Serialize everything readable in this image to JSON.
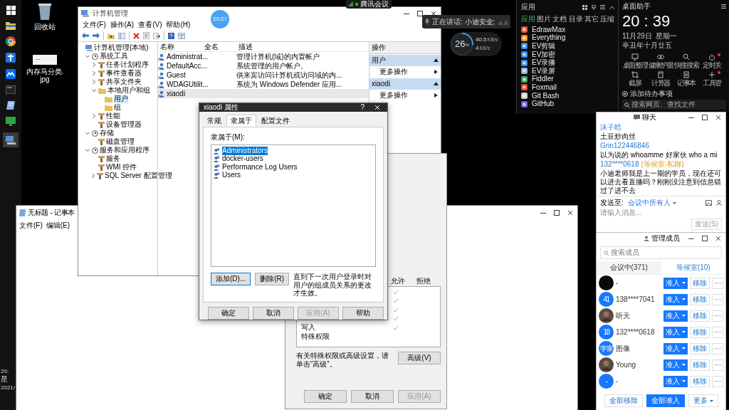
{
  "desktop_icons": [
    {
      "label": "回收站"
    },
    {
      "label": "内存马分类.jpg"
    }
  ],
  "taskbar_clock": [
    "20:",
    "星",
    "2021/"
  ],
  "meeting_bar": {
    "title": "腾讯会议"
  },
  "timer": "29:27",
  "speaking_toast": {
    "text": "正在讲话: 小迪安全;"
  },
  "network_monitor": {
    "level": 0.26,
    "usage": "26",
    "unit": "%",
    "upload": "40.5",
    "upload_unit": "KB/s",
    "download": "4",
    "download_unit": "KB/s"
  },
  "computer_management": {
    "title": "计算机管理",
    "menu": [
      "文件(F)",
      "操作(A)",
      "查看(V)",
      "帮助(H)"
    ],
    "tree": [
      {
        "label": "计算机管理(本地)",
        "selected": false,
        "children": [
          {
            "label": "系统工具",
            "expanded": true,
            "selected": false,
            "children": [
              {
                "label": "任务计划程序",
                "expanded": false,
                "selected": false
              },
              {
                "label": "事件查看器",
                "expanded": false,
                "selected": false
              },
              {
                "label": "共享文件夹",
                "expanded": false,
                "selected": false
              },
              {
                "label": "本地用户和组",
                "expanded": true,
                "selected": false,
                "children": [
                  {
                    "label": "用户",
                    "selected": true
                  },
                  {
                    "label": "组",
                    "selected": false
                  }
                ]
              },
              {
                "label": "性能",
                "expanded": false,
                "selected": false
              },
              {
                "label": "设备管理器",
                "selected": false
              }
            ]
          },
          {
            "label": "存储",
            "expanded": true,
            "selected": false,
            "children": [
              {
                "label": "磁盘管理",
                "selected": false
              }
            ]
          },
          {
            "label": "服务和应用程序",
            "expanded": true,
            "selected": false,
            "children": [
              {
                "label": "服务",
                "selected": false
              },
              {
                "label": "WMI 控件",
                "selected": false
              },
              {
                "label": "SQL Server 配置管理",
                "expanded": false,
                "selected": false
              }
            ]
          }
        ]
      }
    ],
    "columns": [
      "名称",
      "全名",
      "描述"
    ],
    "rows": [
      {
        "name": "Administrat...",
        "description": "管理计算机(域)的内置帐户",
        "selected": false
      },
      {
        "name": "DefaultAcc...",
        "description": "系统管理的用户帐户。",
        "selected": false
      },
      {
        "name": "Guest",
        "description": "供来宾访问计算机或访问域的内...",
        "selected": false
      },
      {
        "name": "WDAGUtilit...",
        "description": "系统为 Windows Defender 应用...",
        "selected": false
      },
      {
        "name": "xiaodi",
        "selected": true
      }
    ],
    "actions": {
      "title": "操作",
      "sections": [
        {
          "title": "用户",
          "items": [
            "更多操作"
          ]
        },
        {
          "title": "xiaodi",
          "items": [
            "更多操作"
          ]
        }
      ]
    }
  },
  "notepad": {
    "title": "无标题 - 记事本",
    "menu": [
      "文件(F)",
      "编辑(E)"
    ]
  },
  "permissions": {
    "columns": [
      "允许",
      "拒绝"
    ],
    "rows": [
      {
        "allow": true,
        "deny": false
      },
      {
        "allow": true,
        "deny": false
      },
      {
        "allow": true,
        "deny": false
      },
      {
        "allow": true,
        "deny": false
      },
      {
        "label": "写入",
        "allow": true,
        "deny": false
      },
      {
        "label": "特殊权限",
        "allow": false,
        "deny": false
      }
    ],
    "note": "有关特殊权限或高级设置，请单击“高级”。",
    "advanced_button": "高级(V)",
    "buttons": [
      {
        "label": "确定",
        "disabled": false
      },
      {
        "label": "取消",
        "disabled": false
      },
      {
        "label": "应用(A)",
        "disabled": true
      }
    ]
  },
  "properties_dialog": {
    "title": "xiaodi 属性",
    "help": "?",
    "tabs": [
      {
        "label": "常规",
        "selected": false
      },
      {
        "label": "隶属于",
        "selected": true
      },
      {
        "label": "配置文件",
        "selected": false
      }
    ],
    "member_of_label": "隶属于(M):",
    "groups": [
      {
        "name": "Administrators",
        "selected": true
      },
      {
        "name": "docker-users",
        "selected": false
      },
      {
        "name": "Performance Log Users",
        "selected": false
      },
      {
        "name": "Users",
        "selected": false
      }
    ],
    "add_button": "添加(D)...",
    "remove_button": "删除(R)",
    "note": "直到下一次用户登录时对用户的组成员关系的更改才生效。",
    "buttons": [
      {
        "label": "确定",
        "disabled": false
      },
      {
        "label": "取消",
        "disabled": false
      },
      {
        "label": "应用(A)",
        "disabled": true
      },
      {
        "label": "帮助",
        "disabled": false
      }
    ]
  },
  "app_launcher": {
    "title": "应用",
    "tabs": [
      {
        "label": "应用",
        "selected": true
      },
      {
        "label": "图片",
        "selected": false
      },
      {
        "label": "文档",
        "selected": false
      },
      {
        "label": "目录",
        "selected": false
      },
      {
        "label": "其它",
        "selected": false
      },
      {
        "label": "压缩",
        "selected": false
      }
    ],
    "apps": [
      "EdrawMax",
      "Everything",
      "EV剪辑",
      "EV加密",
      "EV录播",
      "EV录屏",
      "Fiddler",
      "Foxmail",
      "Git Bash",
      "GitHub"
    ]
  },
  "desktop_assistant": {
    "title": "桌面助手",
    "time": "20 : 39",
    "date": "11月29日",
    "weekday": "星期一",
    "lunar": "辛丑年十月廿五",
    "tools": [
      {
        "label": "桌面整理",
        "badge": false
      },
      {
        "label": "健康护眼",
        "badge": false
      },
      {
        "label": "快搜搜索",
        "badge": false
      },
      {
        "label": "定时关",
        "badge": true
      },
      {
        "label": "截屏",
        "badge": false
      },
      {
        "label": "计算器",
        "badge": false
      },
      {
        "label": "记事本",
        "badge": false
      },
      {
        "label": "工具管",
        "badge": true
      }
    ],
    "add_todo": "添加待办事项",
    "search_placeholder": "搜索网页、查找文件"
  },
  "chat": {
    "title": "聊天",
    "messages": [
      {
        "sender": "沫子晗",
        "text": "土豆炒肉丝"
      },
      {
        "sender": "Grin122446846",
        "text": "以为说的 whoamme  好家伙  who a mi"
      },
      {
        "sender": "132****0618",
        "tag": "(等候室-私聊)",
        "text": "小迪老师我是上一期的学员，现在还可以进去看直播吗？刚刚没注意到信息错过了进不去"
      }
    ],
    "send_to_label": "发送至:",
    "send_to": "会议中所有人",
    "input_placeholder": "请输入消息...",
    "send_button": "发送(S)"
  },
  "members": {
    "title": "管理成员",
    "search_placeholder": "搜索成员",
    "tabs": [
      {
        "label": "会议中(371)",
        "selected": true
      },
      {
        "label": "等候室(10)",
        "selected": false
      }
    ],
    "list": [
      {
        "kind": "plain",
        "color": "#0a0a0a",
        "name": "-",
        "admit": "准入",
        "remove": "移除",
        "more": "···"
      },
      {
        "kind": "initials",
        "initials": "41",
        "color": "#1677ff",
        "name": "138****7041",
        "admit": "准入",
        "remove": "移除",
        "more": "···"
      },
      {
        "kind": "photo",
        "name": "听天",
        "admit": "准入",
        "remove": "移除",
        "more": "···"
      },
      {
        "kind": "initials",
        "initials": "18",
        "color": "#1677ff",
        "name": "132****0618",
        "admit": "准入",
        "remove": "移除",
        "more": "···"
      },
      {
        "kind": "initials",
        "initials": "学家",
        "color": "#1677ff",
        "name": "图像",
        "admit": "准入",
        "remove": "移除",
        "more": "···"
      },
      {
        "kind": "photo",
        "name": "Young",
        "admit": "准入",
        "remove": "移除",
        "more": "···"
      },
      {
        "kind": "initials",
        "initials": "-",
        "color": "#1677ff",
        "name": "-",
        "admit": "准入",
        "remove": "移除",
        "more": "···"
      }
    ],
    "bottom_buttons": [
      "全部移除",
      "全部准入",
      "更多"
    ]
  }
}
